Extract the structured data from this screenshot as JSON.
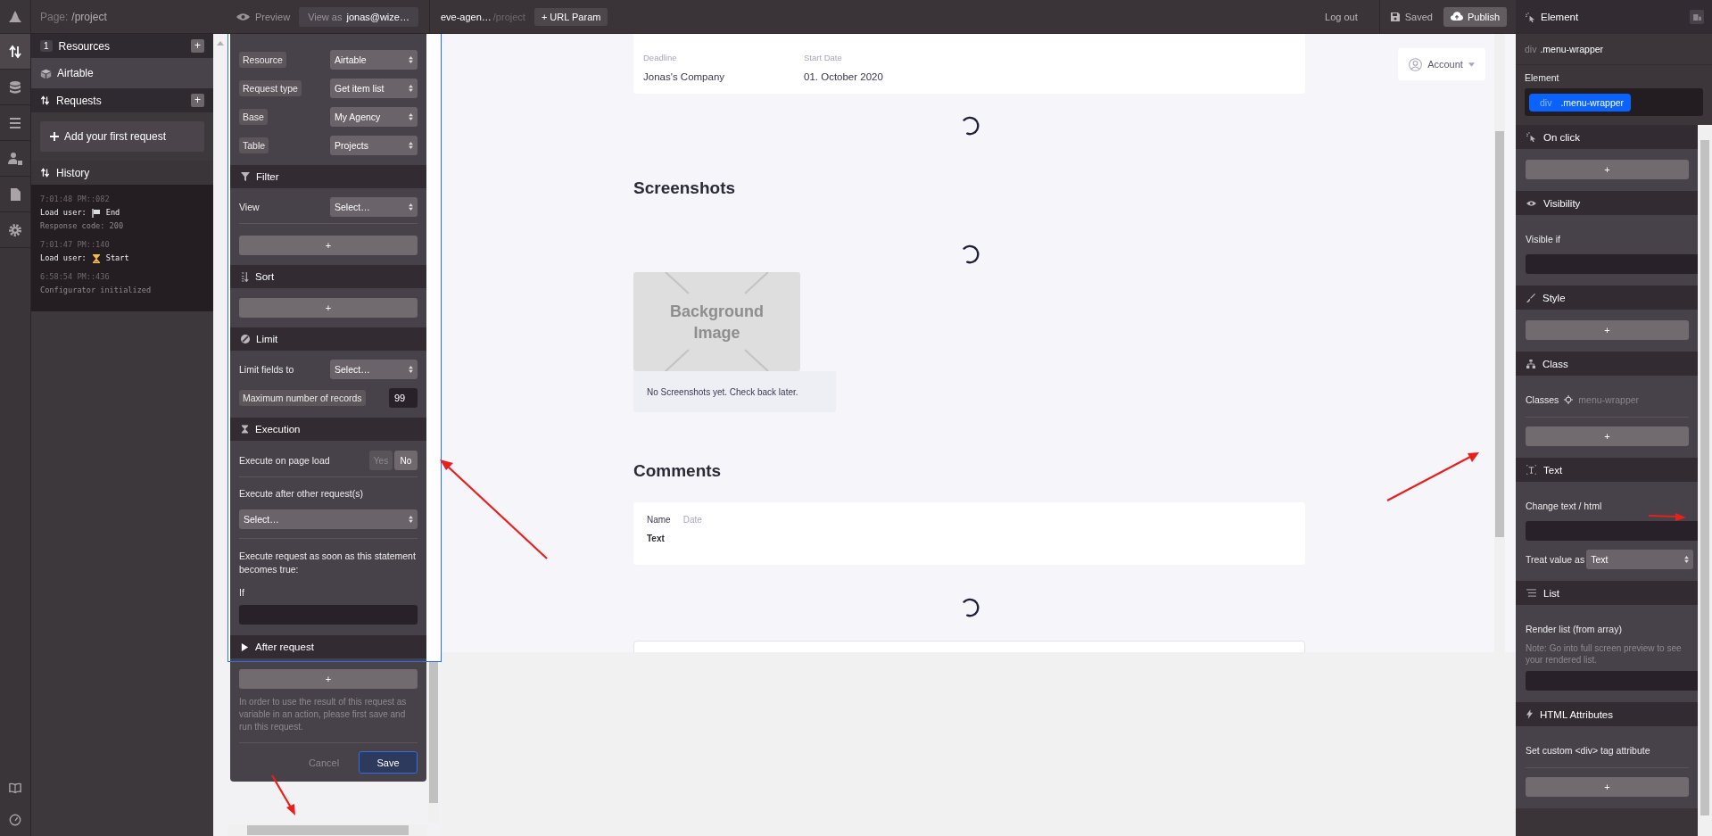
{
  "rail": {
    "items": [
      {
        "kind": "logo",
        "selected": false
      },
      {
        "kind": "requests",
        "selected": true
      },
      {
        "kind": "database",
        "selected": false
      },
      {
        "kind": "list",
        "selected": false
      },
      {
        "kind": "users",
        "selected": false
      },
      {
        "kind": "file",
        "selected": false
      },
      {
        "kind": "settings",
        "selected": false
      }
    ],
    "bottom": [
      {
        "kind": "book"
      },
      {
        "kind": "gauge"
      }
    ]
  },
  "page": {
    "label": "Page:",
    "path": "/project"
  },
  "resources": {
    "count": "1",
    "title": "Resources",
    "add": "+",
    "items": [
      {
        "name": "Airtable"
      }
    ]
  },
  "requests": {
    "title": "Requests",
    "add": "+",
    "add_first": "Add your first request"
  },
  "history": {
    "title": "History",
    "entries": [
      {
        "kind": "end",
        "time": "7:01:48 PM::082",
        "message": "Load user:",
        "status": "End",
        "detail": "Response code: 200"
      },
      {
        "kind": "start",
        "time": "7:01:47 PM::140",
        "message": "Load user:",
        "status": "Start"
      },
      {
        "kind": "info",
        "time": "6:58:54 PM::436",
        "message": "Configurator initialized"
      }
    ]
  },
  "topbar": {
    "preview": "Preview",
    "view_as_label": "View as",
    "view_as_user": "jonas@wize…",
    "project": "eve-agen…",
    "path": "/project",
    "url_param": "+ URL Param",
    "logout": "Log out",
    "saved": "Saved",
    "publish": "Publish"
  },
  "request_form": {
    "fields": [
      {
        "label": "Resource",
        "value": "Airtable"
      },
      {
        "label": "Request type",
        "value": "Get item list"
      },
      {
        "label": "Base",
        "value": "My Agency"
      },
      {
        "label": "Table",
        "value": "Projects"
      }
    ],
    "filter": {
      "title": "Filter",
      "view_label": "View",
      "view_value": "Select…",
      "add": "+"
    },
    "sort": {
      "title": "Sort",
      "add": "+"
    },
    "limit": {
      "title": "Limit",
      "fields_label": "Limit fields to",
      "fields_value": "Select…",
      "max_label": "Maximum number of records",
      "max_value": "99"
    },
    "execution": {
      "title": "Execution",
      "on_load_label": "Execute on page load",
      "options": [
        {
          "label": "Yes",
          "selected": false
        },
        {
          "label": "No",
          "selected": true
        }
      ],
      "after_label": "Execute after other request(s)",
      "after_value": "Select…",
      "condition_label": "Execute request as soon as this statement becomes true:",
      "if_label": "If"
    },
    "after_request": {
      "title": "After request",
      "expanded": false,
      "add": "+",
      "note": "In order to use the result of this request as variable in an action, please first save and run this request."
    },
    "actions": [
      {
        "kind": "cancel",
        "label": "Cancel"
      },
      {
        "kind": "save",
        "label": "Save"
      }
    ]
  },
  "preview": {
    "project_card": {
      "columns": [
        {
          "label": "Deadline",
          "value": "Jonas's Company"
        },
        {
          "label": "Start Date",
          "value": "01. October 2020"
        }
      ]
    },
    "account": "Account",
    "screenshots": {
      "title": "Screenshots",
      "placeholder": "Background Image",
      "empty": "No Screenshots yet. Check back later."
    },
    "comments": {
      "title": "Comments",
      "items": [
        {
          "name": "Name",
          "date": "Date",
          "text": "Text"
        }
      ]
    }
  },
  "element_panel": {
    "title": "Element",
    "selector_tag": "div",
    "selector_class": ".menu-wrapper",
    "element_label": "Element",
    "chip_tag": "div",
    "chip_class": ".menu-wrapper",
    "sections": [
      {
        "kind": "on_click",
        "title": "On click",
        "add": "+"
      },
      {
        "kind": "visibility",
        "title": "Visibility",
        "label": "Visible if"
      },
      {
        "kind": "style",
        "title": "Style",
        "add": "+"
      },
      {
        "kind": "class",
        "title": "Class",
        "label": "Classes",
        "class_value": "menu-wrapper",
        "add": "+"
      },
      {
        "kind": "text",
        "title": "Text",
        "label": "Change text / html",
        "treat_label": "Treat value as",
        "treat_value": "Text"
      },
      {
        "kind": "list",
        "title": "List",
        "label": "Render list (from array)",
        "note": "Note: Go into full screen preview to see your rendered list."
      },
      {
        "kind": "attributes",
        "title": "HTML Attributes",
        "label": "Set custom <div> tag attribute",
        "add": "+"
      }
    ]
  }
}
